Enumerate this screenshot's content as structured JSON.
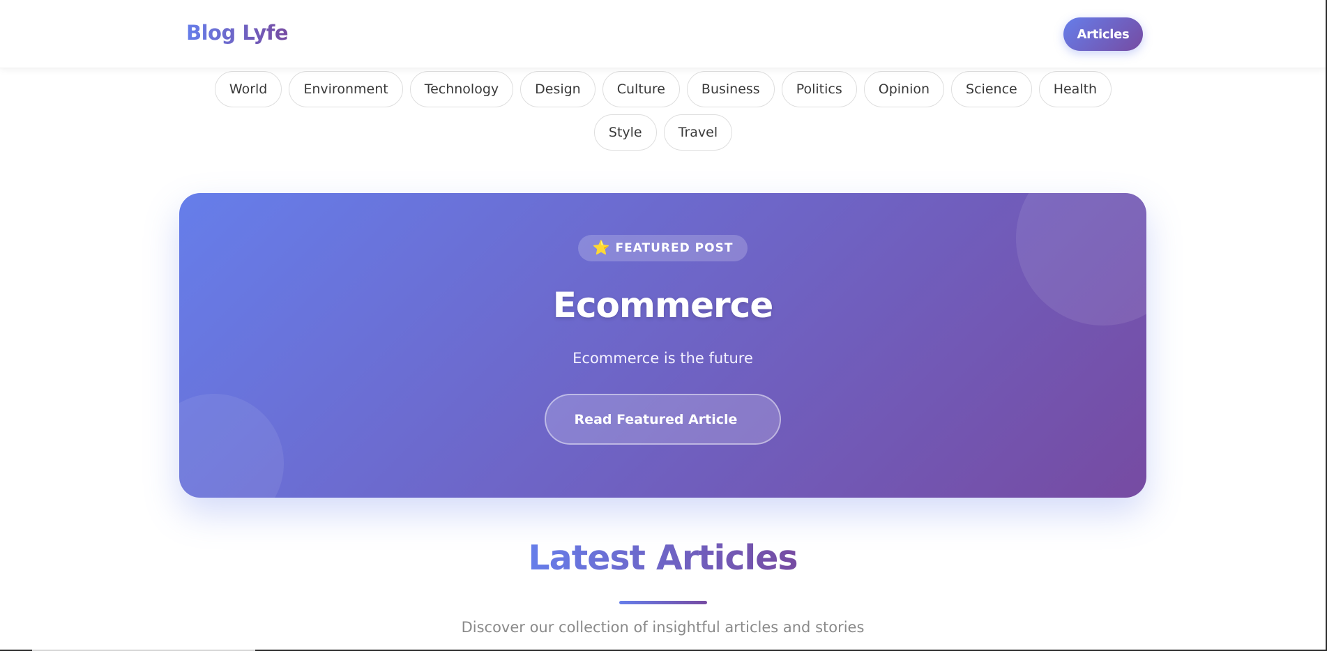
{
  "header": {
    "brand": "Blog Lyfe",
    "nav_button": "Articles"
  },
  "categories": [
    "World",
    "Environment",
    "Technology",
    "Design",
    "Culture",
    "Business",
    "Politics",
    "Opinion",
    "Science",
    "Health",
    "Style",
    "Travel"
  ],
  "hero": {
    "badge_icon": "star-icon",
    "badge_label": "FEATURED POST",
    "title": "Ecommerce",
    "subtitle": "Ecommerce is the future",
    "button_label": "Read Featured Article"
  },
  "latest": {
    "title": "Latest Articles",
    "subtitle": "Discover our collection of insightful articles and stories"
  },
  "colors": {
    "accent_start": "#667eea",
    "accent_end": "#764ba2",
    "star": "#f5c518"
  }
}
